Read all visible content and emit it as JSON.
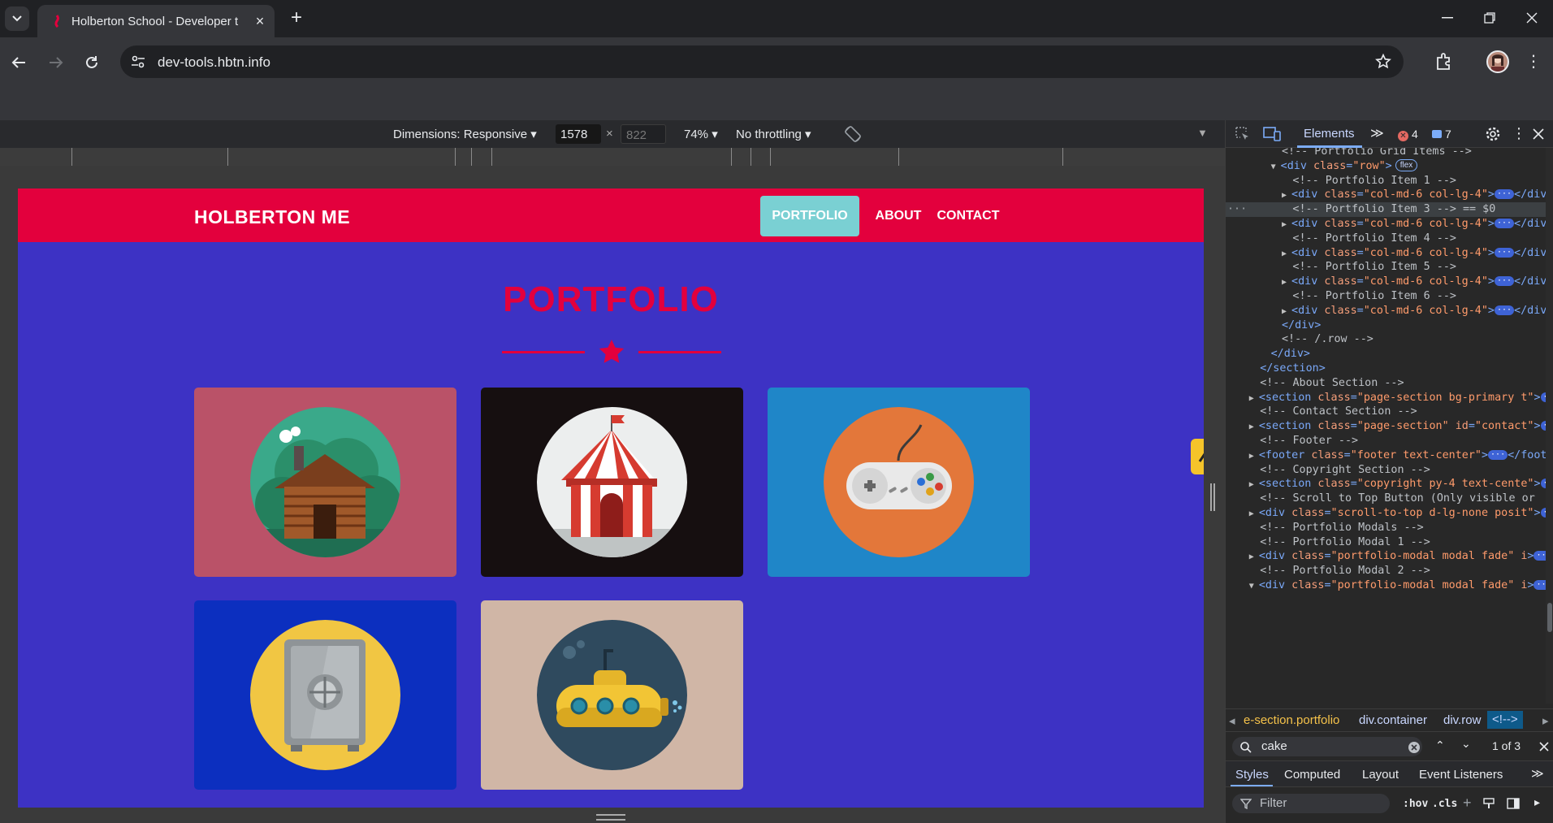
{
  "browser": {
    "tab_title": "Holberton School - Developer t",
    "url": "dev-tools.hbtn.info",
    "new_tab": "+",
    "close_tab": "×"
  },
  "device_toolbar": {
    "dimensions_label": "Dimensions: Responsive",
    "width": "1578",
    "height_placeholder": "822",
    "times": "×",
    "zoom": "74%",
    "throttling": "No throttling"
  },
  "site": {
    "brand": "HOLBERTON ME",
    "nav": [
      "PORTFOLIO",
      "ABOUT",
      "CONTACT"
    ],
    "heading": "PORTFOLIO",
    "cards": [
      {
        "name": "cabin",
        "bg": "#ba5268"
      },
      {
        "name": "circus-tent",
        "bg": "#160f10"
      },
      {
        "name": "game-controller",
        "bg": "#1f86c8"
      },
      {
        "name": "safe",
        "bg": "#0c2fbf"
      },
      {
        "name": "submarine",
        "bg": "#d0b6a6"
      }
    ],
    "accent": "#e3003d",
    "bg": "#3d32c4"
  },
  "devtools": {
    "tab_elements": "Elements",
    "errors": "4",
    "messages": "7",
    "dom_lines": [
      {
        "indent": 5,
        "kind": "comment",
        "text": "<!-- Portfolio Grid Items -->"
      },
      {
        "indent": 4,
        "kind": "open-flex",
        "tri": "▼",
        "tag": "div",
        "attr": "class",
        "val": "row",
        "badge": "flex"
      },
      {
        "indent": 6,
        "kind": "comment",
        "text": "<!-- Portfolio Item 1 -->"
      },
      {
        "indent": 5,
        "kind": "collapsed",
        "tri": "▶",
        "tag": "div",
        "attr": "class",
        "val": "col-md-6 col-lg-4"
      },
      {
        "indent": 6,
        "kind": "comment-selected",
        "text": "<!-- Portfolio Item 3 --> == $0"
      },
      {
        "indent": 5,
        "kind": "collapsed",
        "tri": "▶",
        "tag": "div",
        "attr": "class",
        "val": "col-md-6 col-lg-4"
      },
      {
        "indent": 6,
        "kind": "comment",
        "text": "<!-- Portfolio Item 4 -->"
      },
      {
        "indent": 5,
        "kind": "collapsed",
        "tri": "▶",
        "tag": "div",
        "attr": "class",
        "val": "col-md-6 col-lg-4"
      },
      {
        "indent": 6,
        "kind": "comment",
        "text": "<!-- Portfolio Item 5 -->"
      },
      {
        "indent": 5,
        "kind": "collapsed",
        "tri": "▶",
        "tag": "div",
        "attr": "class",
        "val": "col-md-6 col-lg-4"
      },
      {
        "indent": 6,
        "kind": "comment",
        "text": "<!-- Portfolio Item 6 -->"
      },
      {
        "indent": 5,
        "kind": "collapsed",
        "tri": "▶",
        "tag": "div",
        "attr": "class",
        "val": "col-md-6 col-lg-4"
      },
      {
        "indent": 5,
        "kind": "close",
        "text": "</div>"
      },
      {
        "indent": 5,
        "kind": "comment",
        "text": "<!-- /.row -->"
      },
      {
        "indent": 4,
        "kind": "close",
        "text": "</div>"
      },
      {
        "indent": 3,
        "kind": "close",
        "text": "</section>"
      },
      {
        "indent": 3,
        "kind": "comment",
        "text": "<!-- About Section -->"
      },
      {
        "indent": 2,
        "kind": "collapsed",
        "tri": "▶",
        "tag": "section",
        "attr": "class",
        "val": "page-section bg-primary t"
      },
      {
        "indent": 3,
        "kind": "comment",
        "text": "<!-- Contact Section -->"
      },
      {
        "indent": 2,
        "kind": "collapsed-id",
        "tri": "▶",
        "tag": "section",
        "attr": "class",
        "val": "page-section",
        "attr2": "id",
        "val2": "contact"
      },
      {
        "indent": 3,
        "kind": "comment",
        "text": "<!-- Footer -->"
      },
      {
        "indent": 2,
        "kind": "collapsed",
        "tri": "▶",
        "tag": "footer",
        "attr": "class",
        "val": "footer text-center"
      },
      {
        "indent": 3,
        "kind": "comment",
        "text": "<!-- Copyright Section -->"
      },
      {
        "indent": 2,
        "kind": "collapsed",
        "tri": "▶",
        "tag": "section",
        "attr": "class",
        "val": "copyright py-4 text-cente"
      },
      {
        "indent": 3,
        "kind": "comment",
        "text": "<!-- Scroll to Top Button (Only visible or"
      },
      {
        "indent": 2,
        "kind": "collapsed",
        "tri": "▶",
        "tag": "div",
        "attr": "class",
        "val": "scroll-to-top d-lg-none posit"
      },
      {
        "indent": 3,
        "kind": "comment",
        "text": "<!-- Portfolio Modals -->"
      },
      {
        "indent": 3,
        "kind": "comment",
        "text": "<!-- Portfolio Modal 1 -->"
      },
      {
        "indent": 2,
        "kind": "collapsed",
        "tri": "▶",
        "tag": "div",
        "attr": "class",
        "val": "portfolio-modal modal fade",
        "attr2": "i",
        "val2": ""
      },
      {
        "indent": 3,
        "kind": "comment",
        "text": "<!-- Portfolio Modal 2 -->"
      },
      {
        "indent": 2,
        "kind": "collapsed",
        "tri": "▼",
        "tag": "div",
        "attr": "class",
        "val": "portfolio-modal modal fade",
        "attr2": "i",
        "val2": ""
      }
    ],
    "breadcrumbs": [
      "e-section.portfolio",
      "div.container",
      "div.row",
      "<!-->"
    ],
    "search_value": "cake",
    "search_count": "1 of 3",
    "styles_tabs": [
      "Styles",
      "Computed",
      "Layout",
      "Event Listeners"
    ],
    "filter_placeholder": "Filter",
    "hov": ":hov",
    "cls": ".cls"
  }
}
